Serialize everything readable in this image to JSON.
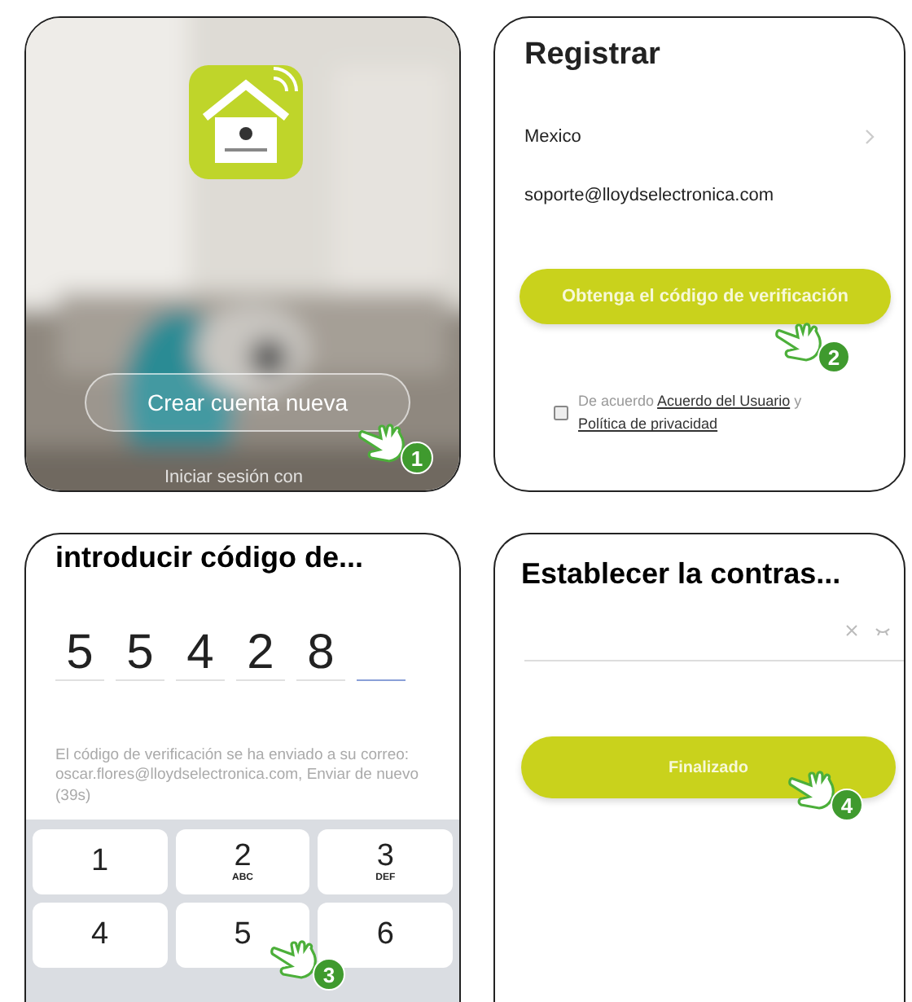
{
  "panels": [
    {
      "kind": "welcome",
      "step": "1",
      "primary_button": "Crear cuenta nueva",
      "secondary_text": "Iniciar sesión con"
    },
    {
      "kind": "register",
      "step": "2",
      "title": "Registrar",
      "country": "Mexico",
      "email": "soporte@lloydselectronica.com",
      "button": "Obtenga el código de verificación",
      "agreement": {
        "prefix": "De acuerdo",
        "link1": "Acuerdo del Usuario",
        "joiner": "y",
        "link2": "Política de privacidad"
      }
    },
    {
      "kind": "code",
      "step": "3",
      "title": "introducir código de...",
      "slots": [
        {
          "digit": "5",
          "active": false
        },
        {
          "digit": "5",
          "active": false
        },
        {
          "digit": "4",
          "active": false
        },
        {
          "digit": "2",
          "active": false
        },
        {
          "digit": "8",
          "active": false
        },
        {
          "active": true
        }
      ],
      "message": "El código de verificación se ha enviado a su correo: oscar.flores@lloydselectronica.com, Enviar de nuevo (39s)",
      "keys": [
        {
          "digit": "1"
        },
        {
          "digit": "2",
          "letters": "ABC"
        },
        {
          "digit": "3",
          "letters": "DEF"
        },
        {
          "digit": "4"
        },
        {
          "digit": "5"
        },
        {
          "digit": "6"
        }
      ]
    },
    {
      "kind": "password",
      "step": "4",
      "title": "Establecer la contras...",
      "button": "Finalizado"
    }
  ]
}
